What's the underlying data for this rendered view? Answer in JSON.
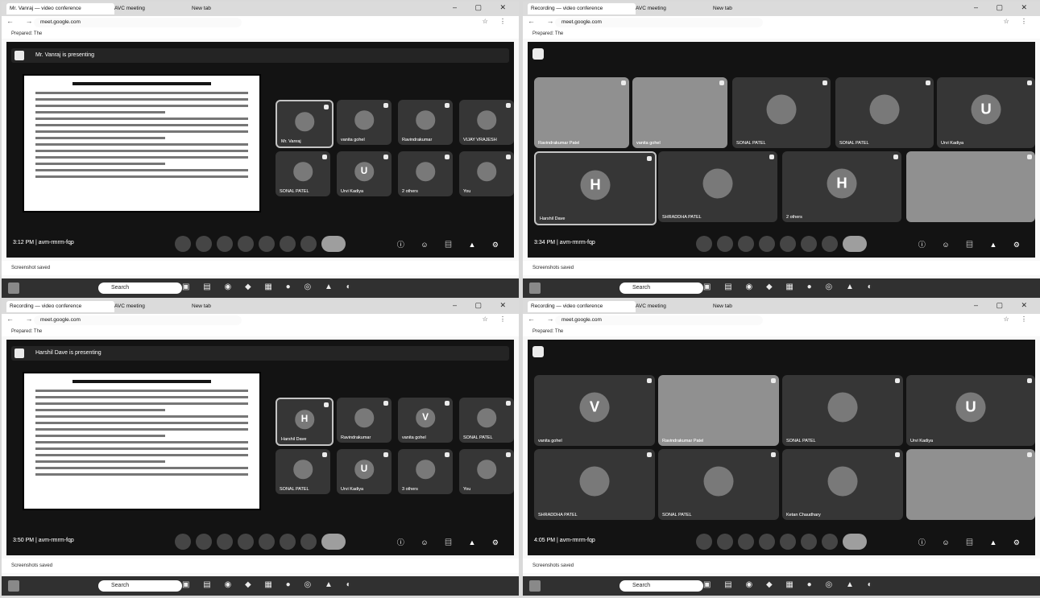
{
  "panels": [
    {
      "tabs": [
        "Mr. Vanraj — video conference",
        "AVC meeting",
        "New tab"
      ],
      "url": "meet.google.com",
      "bookmark": "Prepared: The",
      "presenting": "Mr. Vanraj is presenting",
      "time": "3:12 PM",
      "meeting_code": "avm-rmrm-fqp",
      "status_tabs": "Screenshot saved",
      "participants": [
        {
          "name": "Mr. Vanraj",
          "initial": ""
        },
        {
          "name": "vanita gohel",
          "initial": ""
        },
        {
          "name": "Ravindrakumar",
          "initial": ""
        },
        {
          "name": "VIJAY VRAJESH",
          "initial": ""
        },
        {
          "name": "SONAL PATEL",
          "initial": ""
        },
        {
          "name": "Urvi Kadiya",
          "initial": "U"
        },
        {
          "name": "2 others",
          "initial": ""
        },
        {
          "name": "You",
          "initial": ""
        }
      ]
    },
    {
      "tabs": [
        "Recording — video conference",
        "AVC meeting",
        "New tab"
      ],
      "url": "meet.google.com",
      "bookmark": "Prepared: The",
      "presenting": "",
      "time": "3:34 PM",
      "meeting_code": "avm-rmrm-fqp",
      "status_tabs": "Screenshots saved",
      "participants": [
        {
          "name": "Ravindrakumar Patel",
          "initial": ""
        },
        {
          "name": "vanita gohel",
          "initial": ""
        },
        {
          "name": "SONAL PATEL",
          "initial": ""
        },
        {
          "name": "SONAL PATEL",
          "initial": ""
        },
        {
          "name": "Urvi Kadiya",
          "initial": "U"
        },
        {
          "name": "Harshil Dave",
          "initial": "H"
        },
        {
          "name": "SHRADDHA PATEL",
          "initial": ""
        },
        {
          "name": "2 others",
          "initial": "H"
        },
        {
          "name": "",
          "initial": ""
        }
      ]
    },
    {
      "tabs": [
        "Recording — video conference",
        "AVC meeting",
        "New tab"
      ],
      "url": "meet.google.com",
      "bookmark": "Prepared: The",
      "presenting": "Harshil Dave is presenting",
      "time": "3:50 PM",
      "meeting_code": "avm-rmrm-fqp",
      "status_tabs": "Screenshots saved",
      "participants": [
        {
          "name": "Harshil Dave",
          "initial": "H"
        },
        {
          "name": "Ravindrakumar",
          "initial": ""
        },
        {
          "name": "vanita gohel",
          "initial": "V"
        },
        {
          "name": "SONAL PATEL",
          "initial": ""
        },
        {
          "name": "SONAL PATEL",
          "initial": ""
        },
        {
          "name": "Urvi Kadiya",
          "initial": "U"
        },
        {
          "name": "3 others",
          "initial": ""
        },
        {
          "name": "You",
          "initial": ""
        }
      ]
    },
    {
      "tabs": [
        "Recording — video conference",
        "AVC meeting",
        "New tab"
      ],
      "url": "meet.google.com",
      "bookmark": "Prepared: The",
      "presenting": "",
      "time": "4:05 PM",
      "meeting_code": "avm-rmrm-fqp",
      "status_tabs": "Screenshots saved",
      "participants": [
        {
          "name": "vanita gohel",
          "initial": "V"
        },
        {
          "name": "Ravindrakumar Patel",
          "initial": ""
        },
        {
          "name": "SONAL PATEL",
          "initial": ""
        },
        {
          "name": "Urvi Kadiya",
          "initial": "U"
        },
        {
          "name": "SHRADDHA PATEL",
          "initial": ""
        },
        {
          "name": "SONAL PATEL",
          "initial": ""
        },
        {
          "name": "Ketan Chaudhary",
          "initial": ""
        },
        {
          "name": "",
          "initial": ""
        }
      ]
    }
  ],
  "taskbar": {
    "search_placeholder": "Search"
  }
}
